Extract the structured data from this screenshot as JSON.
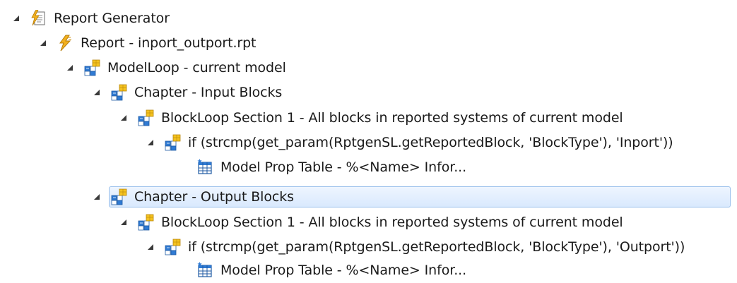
{
  "tree": {
    "nodes": [
      {
        "label": "Report Generator",
        "icon": "report-generator-icon",
        "expanded": true
      },
      {
        "label": "Report - inport_outport.rpt",
        "icon": "report-lightning-icon",
        "expanded": true
      },
      {
        "label": "ModelLoop - current model",
        "icon": "component-blocks-icon",
        "expanded": true
      },
      {
        "label": "Chapter - Input Blocks",
        "icon": "component-blocks-icon",
        "expanded": true
      },
      {
        "label": "BlockLoop Section 1 - All blocks in reported systems of current model",
        "icon": "component-blocks-icon",
        "expanded": true
      },
      {
        "label": "if (strcmp(get_param(RptgenSL.getReportedBlock, 'BlockType'), 'Inport'))",
        "icon": "component-blocks-icon",
        "expanded": true
      },
      {
        "label": "Model Prop Table - %<Name> Infor...",
        "icon": "table-icon",
        "expanded": null
      },
      {
        "label": "Chapter - Output Blocks",
        "icon": "component-blocks-icon",
        "expanded": true,
        "selected": true
      },
      {
        "label": "BlockLoop Section 1 - All blocks in reported systems of current model",
        "icon": "component-blocks-icon",
        "expanded": true
      },
      {
        "label": "if (strcmp(get_param(RptgenSL.getReportedBlock, 'BlockType'), 'Outport'))",
        "icon": "component-blocks-icon",
        "expanded": true
      },
      {
        "label": "Model Prop Table - %<Name> Infor...",
        "icon": "table-icon",
        "expanded": null
      }
    ]
  },
  "colors": {
    "selection_fill": "#dce9fb",
    "selection_border": "#9cc1ec",
    "lightning": "#f2b01e",
    "block_blue": "#2f7ad3",
    "block_yellow": "#f4c21f"
  }
}
